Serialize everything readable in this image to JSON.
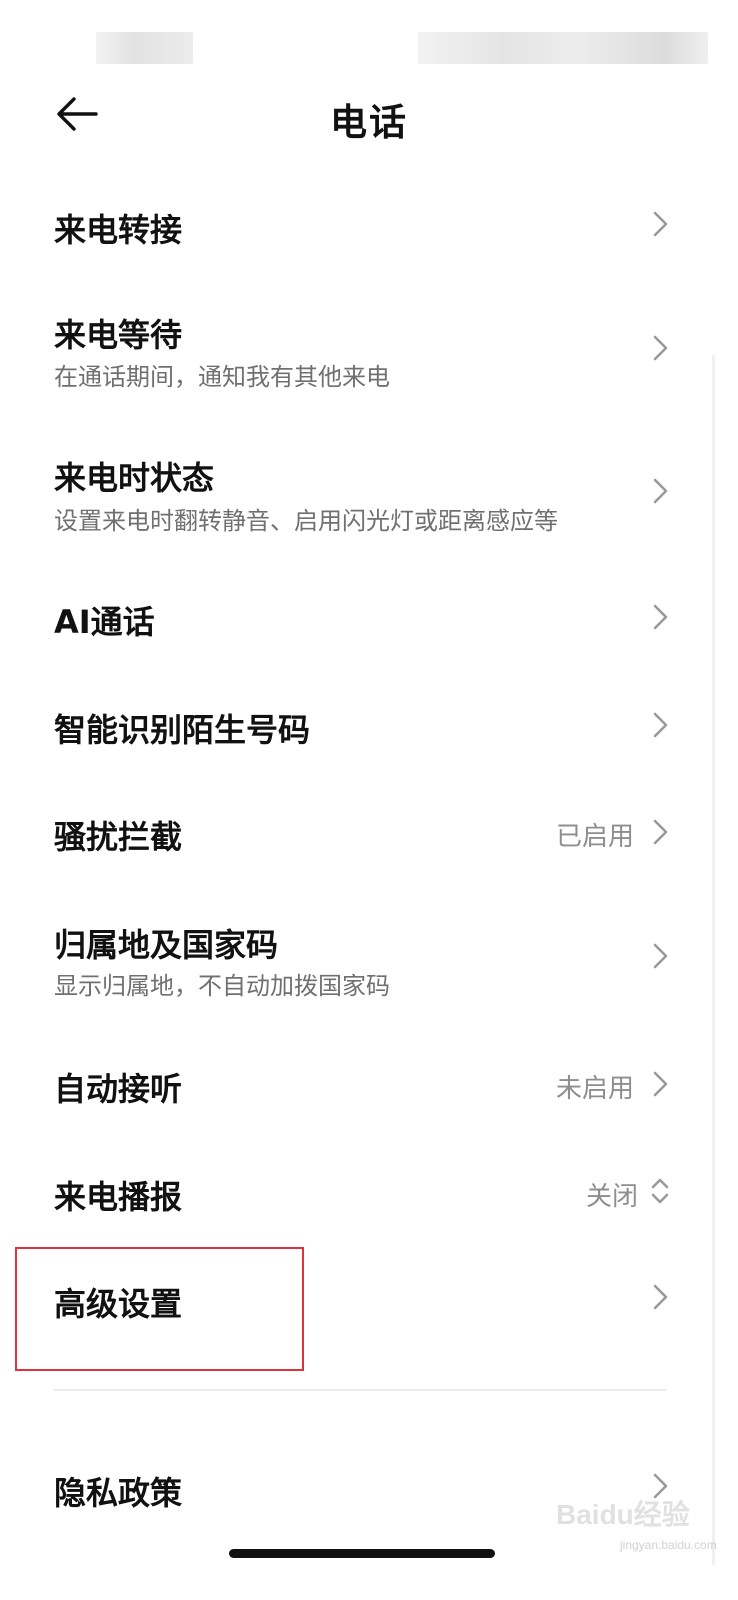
{
  "header": {
    "title": "电话",
    "back_icon": "arrow-left-icon"
  },
  "items": [
    {
      "id": "call-forwarding",
      "label": "来电转接",
      "sub": "",
      "value": "",
      "icon": "chevron-right-icon"
    },
    {
      "id": "call-waiting",
      "label": "来电等待",
      "sub": "在通话期间，通知我有其他来电",
      "value": "",
      "icon": "chevron-right-icon"
    },
    {
      "id": "incoming-call-status",
      "label": "来电时状态",
      "sub": "设置来电时翻转静音、启用闪光灯或距离感应等",
      "value": "",
      "icon": "chevron-right-icon"
    },
    {
      "id": "ai-call",
      "label": "AI通话",
      "sub": "",
      "value": "",
      "icon": "chevron-right-icon"
    },
    {
      "id": "identify-unknown",
      "label": "智能识别陌生号码",
      "sub": "",
      "value": "",
      "icon": "chevron-right-icon"
    },
    {
      "id": "harassment-block",
      "label": "骚扰拦截",
      "sub": "",
      "value": "已启用",
      "icon": "chevron-right-icon"
    },
    {
      "id": "region-country-code",
      "label": "归属地及国家码",
      "sub": "显示归属地，不自动加拨国家码",
      "value": "",
      "icon": "chevron-right-icon"
    },
    {
      "id": "auto-answer",
      "label": "自动接听",
      "sub": "",
      "value": "未启用",
      "icon": "chevron-right-icon"
    },
    {
      "id": "caller-announcement",
      "label": "来电播报",
      "sub": "",
      "value": "关闭",
      "icon": "chevron-up-down-icon"
    },
    {
      "id": "advanced-settings",
      "label": "高级设置",
      "sub": "",
      "value": "",
      "icon": "chevron-right-icon"
    },
    {
      "id": "privacy-policy",
      "label": "隐私政策",
      "sub": "",
      "value": "",
      "icon": "chevron-right-icon"
    }
  ],
  "watermark": {
    "text": "Baidu经验",
    "sub": "jingyan.baidu.com"
  },
  "colors": {
    "highlight": "#e0323a",
    "secondary_text": "#707070",
    "value_text": "#8e8e8e"
  }
}
